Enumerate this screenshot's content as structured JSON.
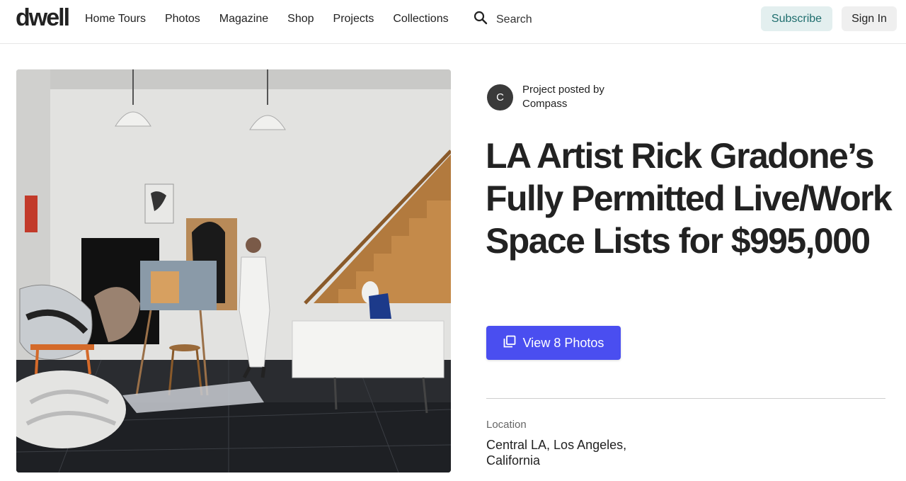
{
  "header": {
    "logo": "dwell",
    "nav": [
      "Home Tours",
      "Photos",
      "Magazine",
      "Shop",
      "Projects",
      "Collections"
    ],
    "search_label": "Search",
    "subscribe_label": "Subscribe",
    "signin_label": "Sign In"
  },
  "poster": {
    "avatar_initial": "C",
    "prefix": "Project posted by",
    "name": "Compass"
  },
  "article": {
    "title": "LA Artist Rick Gradone’s Fully Permitted Live/Work Space Lists for $995,000",
    "view_photos_label": "View 8 Photos",
    "location_label": "Location",
    "location_value": "Central LA, Los Angeles, California"
  },
  "colors": {
    "accent": "#4a4ef0",
    "subscribe_bg": "#e3efef",
    "subscribe_text": "#1f6e6e"
  },
  "icons": {
    "search": "search-icon",
    "gallery": "gallery-icon"
  }
}
